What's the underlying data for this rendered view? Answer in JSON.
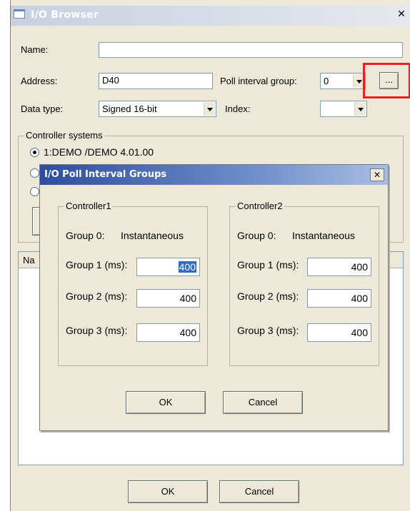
{
  "main_window": {
    "title": "I/O Browser",
    "close_glyph": "✕",
    "name_label": "Name:",
    "name_value": "",
    "address_label": "Address:",
    "address_value": "D40",
    "poll_group_label": "Poll interval group:",
    "poll_group_value": "0",
    "browse_button_label": "...",
    "data_type_label": "Data type:",
    "data_type_value": "Signed 16-bit",
    "index_label": "Index:",
    "index_value": "",
    "controller_systems_label": "Controller systems",
    "controller_systems": [
      {
        "label": "1:DEMO /DEMO  4.01.00",
        "selected": true
      }
    ],
    "list_header_fragment": "Na",
    "ok_label": "OK",
    "cancel_label": "Cancel",
    "highlight_color": "#e8231e"
  },
  "dialog": {
    "title": "I/O Poll Interval Groups",
    "close_glyph": "✕",
    "controllers": [
      {
        "name": "Controller1",
        "group0_label": "Group 0:",
        "group0_value": "Instantaneous",
        "group1_label": "Group 1 (ms):",
        "group1_value": "400",
        "group2_label": "Group 2 (ms):",
        "group2_value": "400",
        "group3_label": "Group 3 (ms):",
        "group3_value": "400"
      },
      {
        "name": "Controller2",
        "group0_label": "Group 0:",
        "group0_value": "Instantaneous",
        "group1_label": "Group 1 (ms):",
        "group1_value": "400",
        "group2_label": "Group 2 (ms):",
        "group2_value": "400",
        "group3_label": "Group 3 (ms):",
        "group3_value": "400"
      }
    ],
    "ok_label": "OK",
    "cancel_label": "Cancel",
    "title_bar_color": "#2d4ea0"
  }
}
